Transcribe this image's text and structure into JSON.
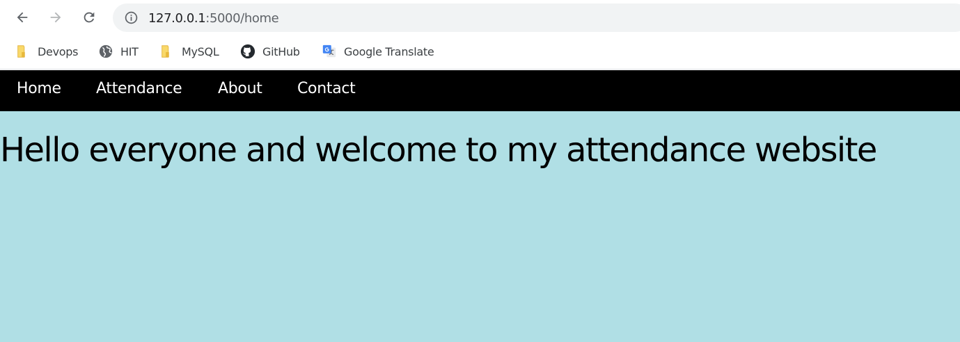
{
  "browser": {
    "url_host": "127.0.0.1",
    "url_rest": ":5000/home",
    "bookmarks": [
      {
        "label": "Devops",
        "icon": "folder-icon"
      },
      {
        "label": "HIT",
        "icon": "globe-icon"
      },
      {
        "label": "MySQL",
        "icon": "folder-icon"
      },
      {
        "label": "GitHub",
        "icon": "github-icon"
      },
      {
        "label": "Google Translate",
        "icon": "google-translate-icon"
      }
    ]
  },
  "site_nav": {
    "items": [
      {
        "label": "Home"
      },
      {
        "label": "Attendance"
      },
      {
        "label": "About"
      },
      {
        "label": "Contact"
      }
    ]
  },
  "main": {
    "heading": "Hello everyone and welcome to my attendance website"
  },
  "colors": {
    "nav_background": "#000000",
    "content_background": "#b0dfe5",
    "folder_yellow": "#f9d96a"
  }
}
